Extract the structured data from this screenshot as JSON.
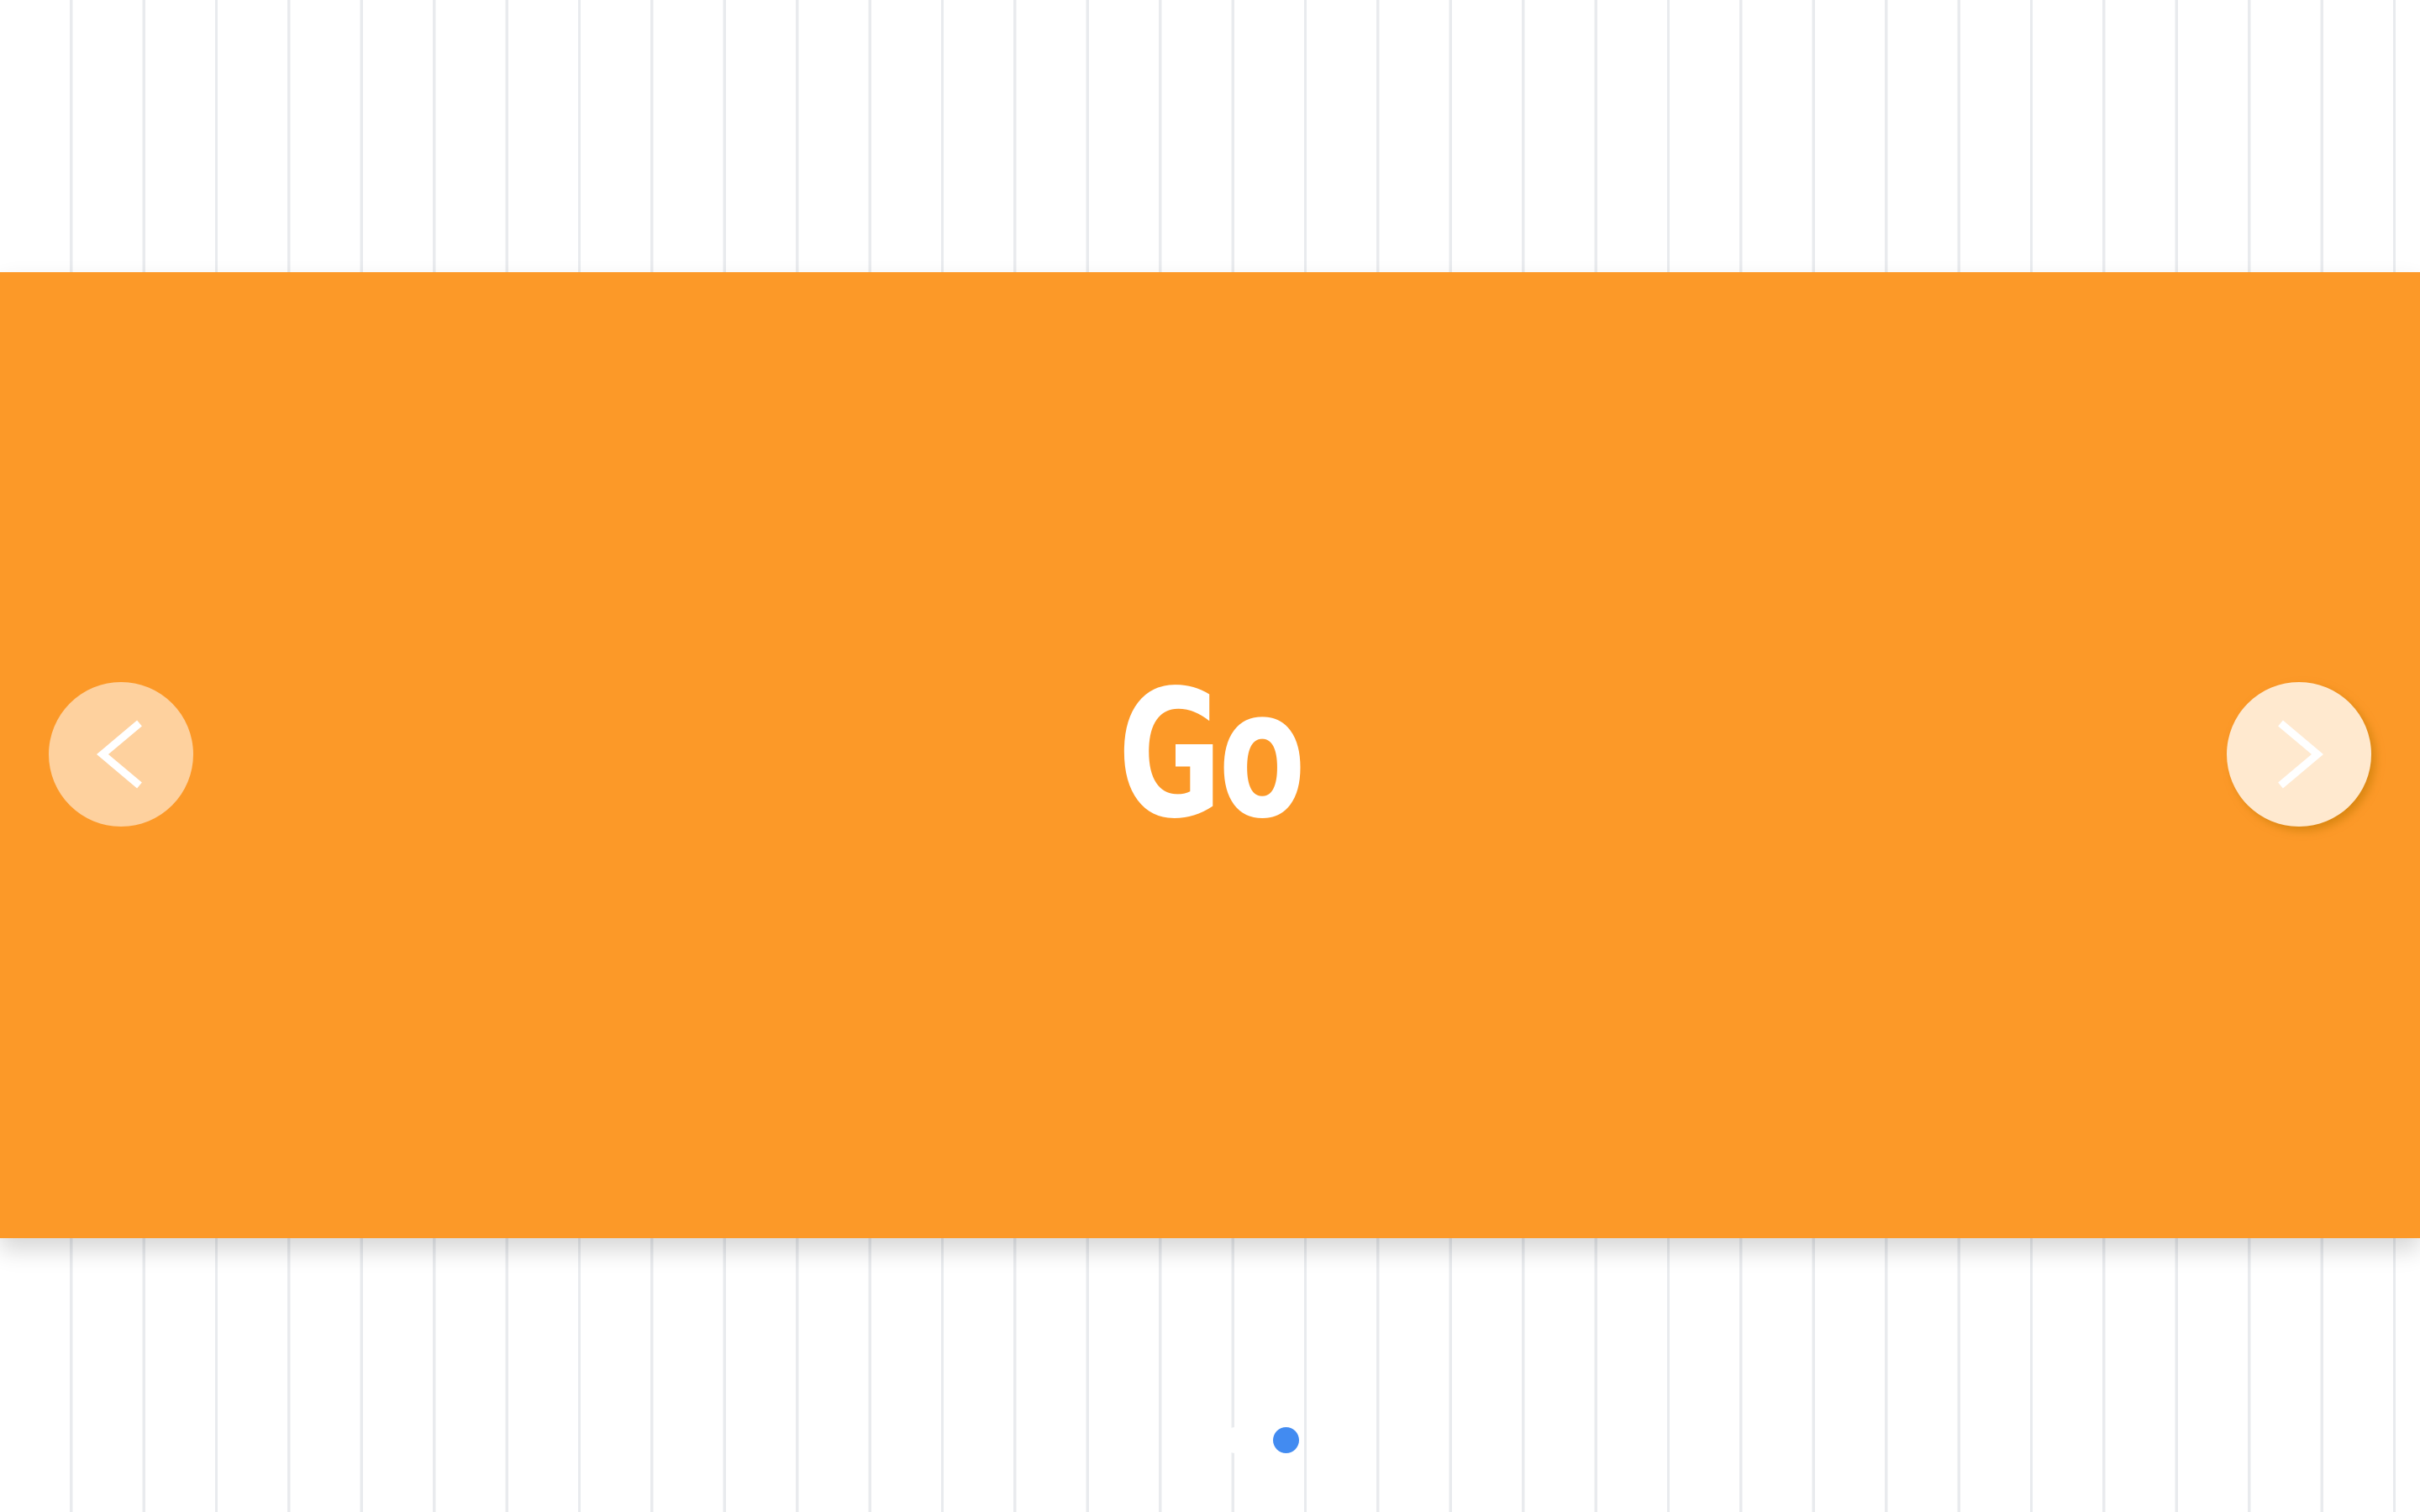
{
  "slide": {
    "title": "Go"
  },
  "navigation": {
    "prev_label": "<",
    "next_label": ">",
    "prev_icon": "chevron-left-icon",
    "next_icon": "chevron-right-icon"
  },
  "pagination": {
    "total": 4,
    "current": 4
  },
  "colors": {
    "slide_background": "#fc9928",
    "text": "#ffffff",
    "dot_inactive": "#ffffff",
    "dot_active": "#428bf1"
  }
}
